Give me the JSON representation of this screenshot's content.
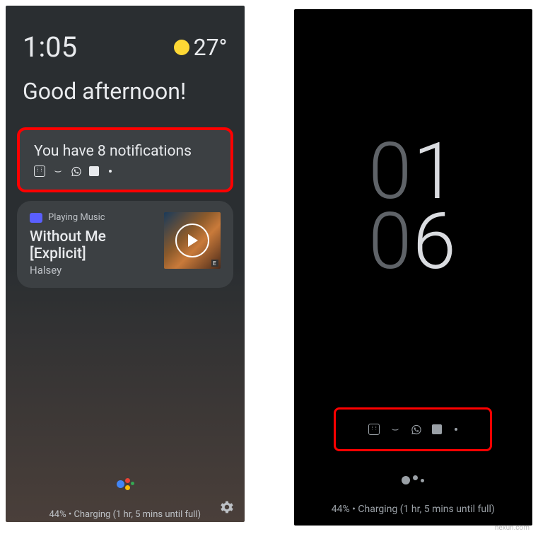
{
  "left": {
    "time": "1:05",
    "temperature": "27°",
    "greeting": "Good afternoon!",
    "notifications": {
      "title": "You have 8 notifications",
      "icons": [
        "calendar-icon",
        "amazon-icon",
        "whatsapp-icon",
        "app-icon",
        "more-dot-icon"
      ]
    },
    "media": {
      "source": "Playing Music",
      "title": "Without Me [Explicit]",
      "artist": "Halsey"
    },
    "charging": "44% • Charging (1 hr, 5 mins until full)"
  },
  "right": {
    "clock": {
      "h1": "0",
      "h2": "1",
      "m1": "0",
      "m2": "6"
    },
    "icons": [
      "calendar-icon",
      "amazon-icon",
      "whatsapp-icon",
      "app-icon",
      "more-dot-icon"
    ],
    "charging": "44% • Charging (1 hr, 5 mins until full)"
  },
  "watermark": "nexun.com"
}
